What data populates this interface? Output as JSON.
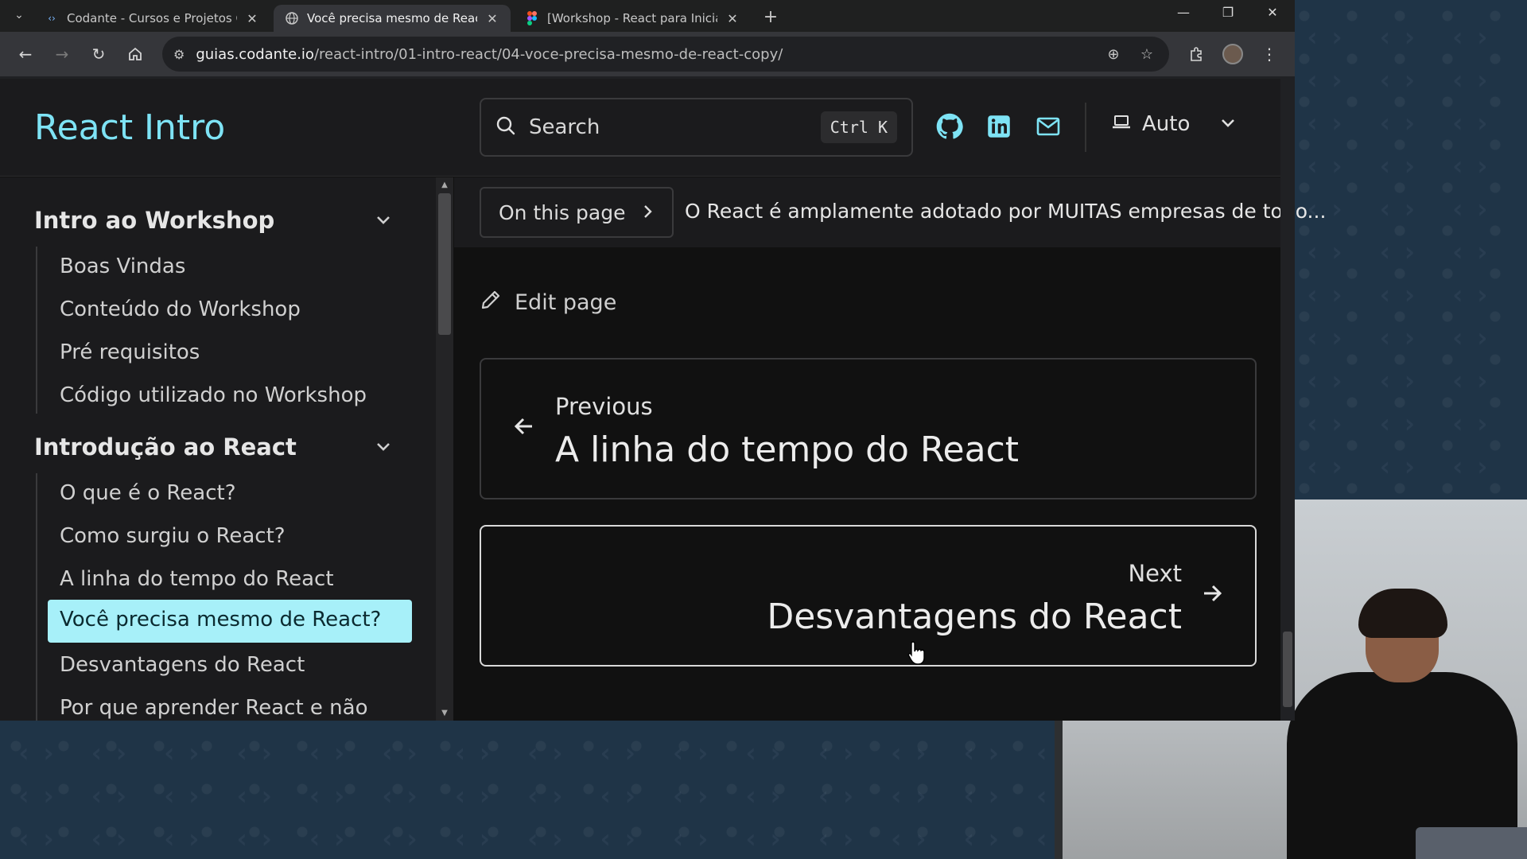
{
  "tabs": [
    {
      "title": "Codante - Cursos e Projetos On",
      "icon": "code-icon",
      "active": false
    },
    {
      "title": "Você precisa mesmo de React?",
      "icon": "globe-icon",
      "active": true
    },
    {
      "title": "[Workshop - React para Iniciant",
      "icon": "figma-icon",
      "active": false
    }
  ],
  "toolbar": {
    "url_host": "guias.codante.io",
    "url_path": "/react-intro/01-intro-react/04-voce-precisa-mesmo-de-react-copy/"
  },
  "header": {
    "site_title": "React Intro",
    "search_label": "Search",
    "search_shortcut": "Ctrl K",
    "theme_label": "Auto"
  },
  "sidebar": {
    "groups": [
      {
        "title": "Intro ao Workshop",
        "items": [
          "Boas Vindas",
          "Conteúdo do Workshop",
          "Pré requisitos",
          "Código utilizado no Workshop"
        ]
      },
      {
        "title": "Introdução ao React",
        "items": [
          "O que é o React?",
          "Como surgiu o React?",
          "A linha do tempo do React",
          "Você precisa mesmo de React?",
          "Desvantagens do React",
          "Por que aprender React e não"
        ]
      }
    ],
    "active_item": "Você precisa mesmo de React?"
  },
  "main": {
    "toc_label": "On this page",
    "toc_preview": "O React é amplamente adotado por MUITAS empresas de todo...",
    "edit_label": "Edit page",
    "previous": {
      "label": "Previous",
      "title": "A linha do tempo do React"
    },
    "next": {
      "label": "Next",
      "title": "Desvantagens do React"
    }
  },
  "colors": {
    "accent": "#7ee3f5",
    "active_bg": "#a7f0f9"
  }
}
